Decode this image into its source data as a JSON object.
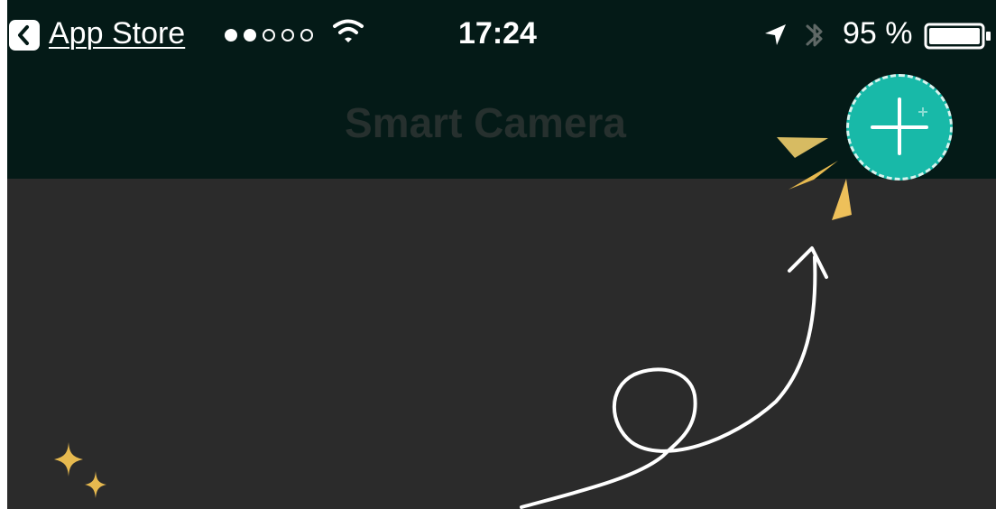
{
  "status_bar": {
    "back_label": "App Store",
    "time": "17:24",
    "battery_percent": "95 %",
    "signal_strength": "2 of 5 bars",
    "icons": [
      "back-chevron-icon",
      "signal-dots-icon",
      "wifi-icon",
      "location-arrow-icon",
      "bluetooth-icon",
      "battery-icon"
    ]
  },
  "nav_bar": {
    "title": "Smart Camera",
    "add_button_icon": "plus-icon"
  },
  "onboarding": {
    "decorations": [
      "burst-lines-icon",
      "curly-arrow-icon",
      "sparkle-icon"
    ]
  },
  "colors": {
    "status_background": "#041a17",
    "content_background": "#2b2b2b",
    "accent_teal": "#18b9a8",
    "decoration_gold": "#e6b94f",
    "arrow_white": "#ffffff"
  }
}
